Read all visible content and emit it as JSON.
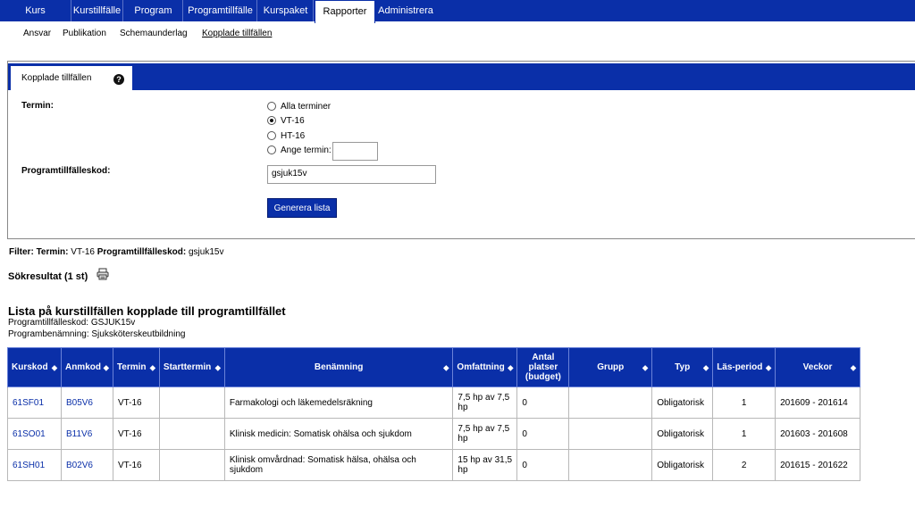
{
  "topnav": [
    {
      "label": "Kurs",
      "active": false
    },
    {
      "label": "Kurstillfälle",
      "active": false
    },
    {
      "label": "Program",
      "active": false
    },
    {
      "label": "Programtillfälle",
      "active": false
    },
    {
      "label": "Kurspaket",
      "active": false
    },
    {
      "label": "Rapporter",
      "active": true
    },
    {
      "label": "Administrera",
      "active": false
    }
  ],
  "subnav": [
    {
      "label": "Ansvar"
    },
    {
      "label": "Publikation"
    },
    {
      "label": "Schemaunderlag"
    },
    {
      "label": "Kopplade tillfällen",
      "current": true
    }
  ],
  "panel": {
    "tab_label": "Kopplade tillfällen",
    "help_icon": "?",
    "termin_label": "Termin:",
    "termin_options": [
      {
        "label": "Alla terminer",
        "checked": false
      },
      {
        "label": "VT-16",
        "checked": true
      },
      {
        "label": "HT-16",
        "checked": false
      },
      {
        "label": "Ange termin:",
        "checked": false
      }
    ],
    "ange_termin_value": "",
    "programkod_label": "Programtillfälleskod:",
    "programkod_value": "gsjuk15v",
    "generate_button": "Generera lista"
  },
  "filter": {
    "prefix": "Filter:",
    "termin_label": "Termin:",
    "termin_value": "VT-16",
    "kod_label": "Programtillfälleskod:",
    "kod_value": "gsjuk15v"
  },
  "results_label": "Sökresultat (1 st)",
  "list": {
    "title": "Lista på kurstillfällen kopplade till programtillfället",
    "programkod_line": "Programtillfälleskod: GSJUK15v",
    "programnamn_line": "Programbenämning: Sjuksköterskeutbildning"
  },
  "table": {
    "headers": [
      "Kurskod",
      "Anmkod",
      "Termin",
      "Starttermin",
      "Benämning",
      "Omfattning",
      "Antal platser (budget)",
      "Grupp",
      "Typ",
      "Läs-period",
      "Veckor"
    ],
    "rows": [
      [
        "61SF01",
        "B05V6",
        "VT-16",
        "",
        "Farmakologi och läkemedelsräkning",
        "7,5 hp av 7,5 hp",
        "0",
        "",
        "Obligatorisk",
        "1",
        "201609 - 201614"
      ],
      [
        "61SO01",
        "B11V6",
        "VT-16",
        "",
        "Klinisk medicin: Somatisk ohälsa och sjukdom",
        "7,5 hp av 7,5 hp",
        "0",
        "",
        "Obligatorisk",
        "1",
        "201603 - 201608"
      ],
      [
        "61SH01",
        "B02V6",
        "VT-16",
        "",
        "Klinisk omvårdnad: Somatisk hälsa, ohälsa och sjukdom",
        "15 hp av 31,5 hp",
        "0",
        "",
        "Obligatorisk",
        "2",
        "201615 - 201622"
      ]
    ]
  }
}
